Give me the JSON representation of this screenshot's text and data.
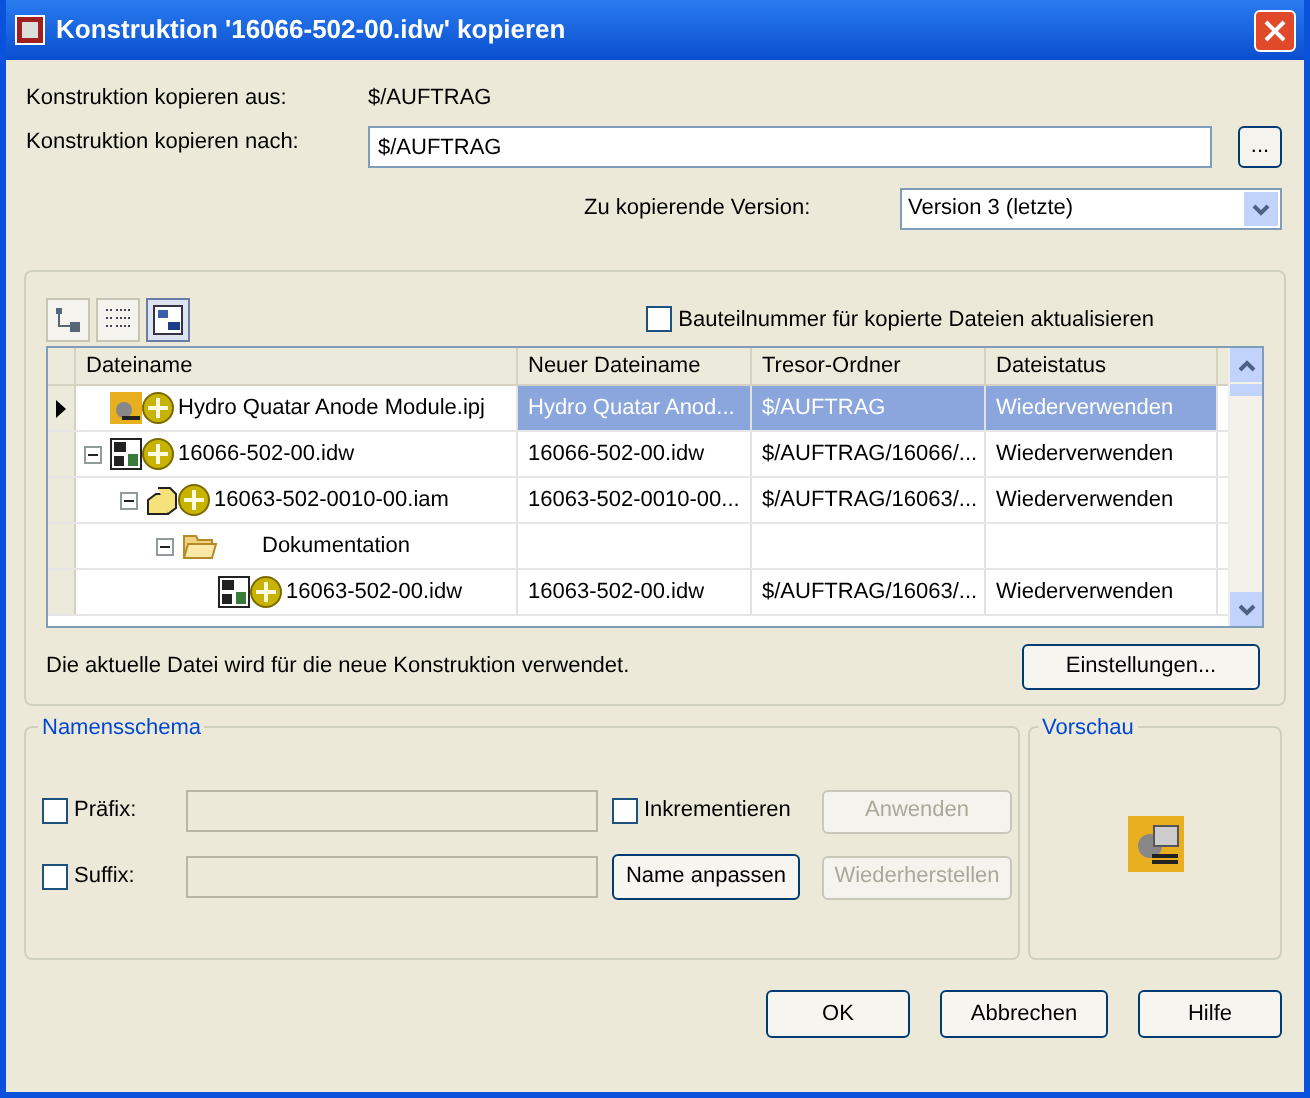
{
  "window": {
    "title": "Konstruktion '16066-502-00.idw' kopieren"
  },
  "copy_from": {
    "label": "Konstruktion kopieren aus:",
    "value": "$/AUFTRAG"
  },
  "copy_to": {
    "label": "Konstruktion kopieren nach:",
    "value": "$/AUFTRAG",
    "browse": "..."
  },
  "version": {
    "label": "Zu kopierende Version:",
    "value": "Version 3 (letzte)"
  },
  "update_part_numbers": {
    "label": "Bauteilnummer für kopierte Dateien aktualisieren",
    "checked": false
  },
  "table": {
    "columns": [
      "Dateiname",
      "Neuer Dateiname",
      "Tresor-Ordner",
      "Dateistatus"
    ],
    "rows": [
      {
        "kind": "project",
        "name": "Hydro Quatar Anode Module.ipj",
        "new_name": "Hydro Quatar Anod...",
        "folder": "$/AUFTRAG",
        "status": "Wiederverwenden",
        "selected": true
      },
      {
        "kind": "drawing",
        "name": "16066-502-00.idw",
        "new_name": "16066-502-00.idw",
        "folder": "$/AUFTRAG/16066/...",
        "status": "Wiederverwenden",
        "selected": false,
        "expanded": true,
        "children": [
          {
            "kind": "assembly",
            "name": "16063-502-0010-00.iam",
            "new_name": "16063-502-0010-00...",
            "folder": "$/AUFTRAG/16063/...",
            "status": "Wiederverwenden",
            "selected": false,
            "expanded": true,
            "children": [
              {
                "kind": "folder",
                "name": "Dokumentation",
                "selected": false,
                "expanded": true,
                "children": [
                  {
                    "kind": "drawing",
                    "name": "16063-502-00.idw",
                    "new_name": "16063-502-00.idw",
                    "folder": "$/AUFTRAG/16063/...",
                    "status": "Wiederverwenden",
                    "selected": false
                  }
                ]
              }
            ]
          }
        ]
      }
    ]
  },
  "info": "Die aktuelle Datei wird für die neue Konstruktion verwendet.",
  "settings_button": "Einstellungen...",
  "naming": {
    "title": "Namensschema",
    "prefix": {
      "label": "Präfix:",
      "checked": false
    },
    "suffix": {
      "label": "Suffix:",
      "checked": false
    },
    "increment": {
      "label": "Inkrementieren",
      "checked": false
    },
    "apply": {
      "label": "Anwenden",
      "disabled": true
    },
    "rename": {
      "label": "Name anpassen",
      "disabled": false
    },
    "restore": {
      "label": "Wiederherstellen",
      "disabled": true
    }
  },
  "preview": {
    "title": "Vorschau"
  },
  "buttons": [
    "OK",
    "Abbrechen",
    "Hilfe"
  ]
}
